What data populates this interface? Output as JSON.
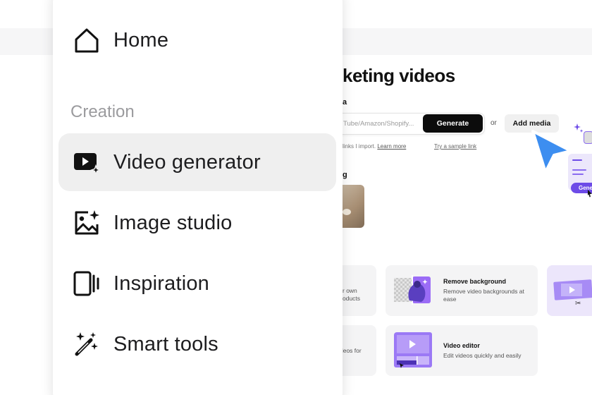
{
  "background": {
    "page_title": "keting videos",
    "media_label": "a",
    "url_input": {
      "placeholder": "Tube/Amazon/Shopify..."
    },
    "generate_label": "Generate",
    "or_label": "or",
    "add_media_label": "Add media",
    "hint_text": "links I import.",
    "hint_link": "Learn more",
    "sample_link": "Try a sample link",
    "section_partial": "g",
    "cards": [
      {
        "partial_lines": [
          "r own",
          "oducts"
        ]
      },
      {
        "title": "Remove background",
        "description": "Remove video backgrounds at ease"
      },
      {
        "partial_lines": [
          "deos for",
          "s"
        ]
      },
      {
        "title": "Video editor",
        "description": "Edit videos quickly and easily"
      }
    ],
    "gen_pill_label": "Gene",
    "accent_color": "#6d4be7",
    "cursor_color": "#3d8ef0"
  },
  "menu": {
    "home": {
      "label": "Home",
      "icon": "home-icon"
    },
    "section_label": "Creation",
    "items": [
      {
        "label": "Video generator",
        "icon": "video-sparkle-icon",
        "active": true
      },
      {
        "label": "Image studio",
        "icon": "image-sparkle-icon",
        "active": false
      },
      {
        "label": "Inspiration",
        "icon": "inspiration-icon",
        "active": false
      },
      {
        "label": "Smart tools",
        "icon": "magic-wand-icon",
        "active": false
      }
    ]
  }
}
